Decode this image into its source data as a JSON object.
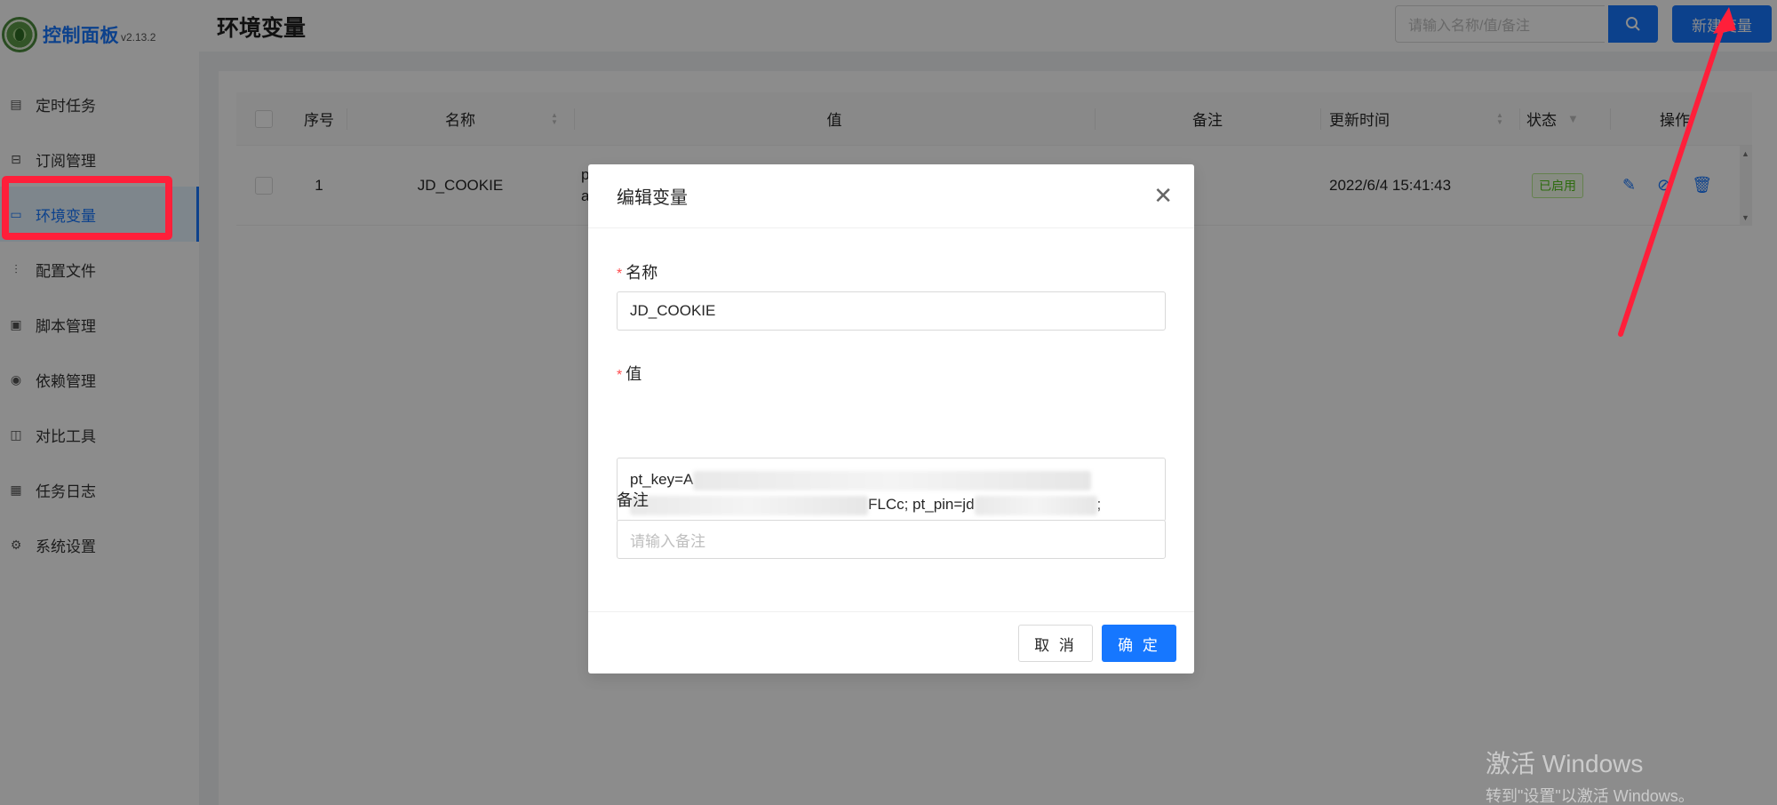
{
  "brand": {
    "title": "控制面板",
    "version": "v2.13.2"
  },
  "sidebar": {
    "items": [
      {
        "label": "定时任务",
        "icon": "calendar-icon"
      },
      {
        "label": "订阅管理",
        "icon": "subscribe-icon"
      },
      {
        "label": "环境变量",
        "icon": "monitor-icon"
      },
      {
        "label": "配置文件",
        "icon": "sliders-icon"
      },
      {
        "label": "脚本管理",
        "icon": "script-icon"
      },
      {
        "label": "依赖管理",
        "icon": "database-icon"
      },
      {
        "label": "对比工具",
        "icon": "diff-icon"
      },
      {
        "label": "任务日志",
        "icon": "log-icon"
      },
      {
        "label": "系统设置",
        "icon": "gear-icon"
      }
    ],
    "active_index": 2
  },
  "header": {
    "title": "环境变量",
    "search_placeholder": "请输入名称/值/备注",
    "new_button": "新建变量"
  },
  "table": {
    "columns": [
      "序号",
      "名称",
      "值",
      "备注",
      "更新时间",
      "状态",
      "操作"
    ],
    "rows": [
      {
        "index": "1",
        "name": "JD_COOKIE",
        "value_line1": "p",
        "value_line2": "a",
        "remark": "",
        "updated": "2022/6/4 15:41:43",
        "status": "已启用"
      }
    ]
  },
  "modal": {
    "title": "编辑变量",
    "name_label": "名称",
    "name_value": "JD_COOKIE",
    "value_label": "值",
    "value_prefix": "pt_key=A",
    "value_middle": "FLCc; pt_pin=jd",
    "value_suffix": ";",
    "remark_label": "备注",
    "remark_placeholder": "请输入备注",
    "cancel": "取 消",
    "ok": "确 定"
  },
  "watermark": {
    "line1": "激活 Windows",
    "line2": "转到\"设置\"以激活 Windows。"
  },
  "colors": {
    "primary": "#1677ff",
    "annotation_red": "#ff1f3a",
    "success": "#52c41a"
  }
}
